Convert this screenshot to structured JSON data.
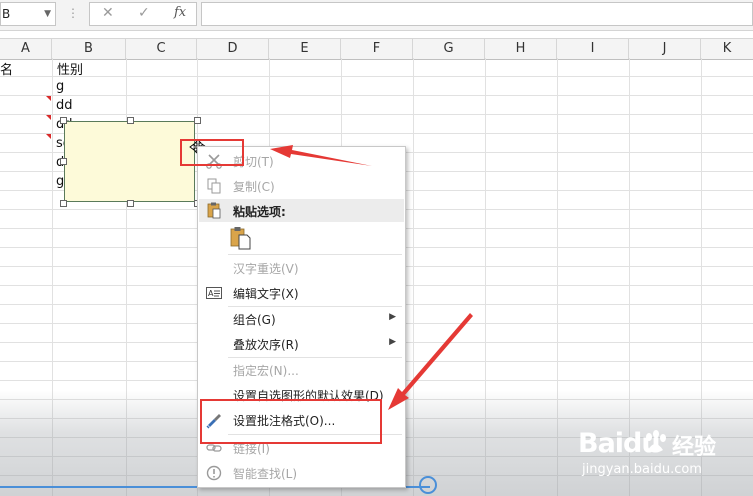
{
  "formula_bar": {
    "name_box": "B",
    "cancel_icon": "✕",
    "enter_icon": "✓",
    "fx_label": "fx"
  },
  "columns": [
    "A",
    "B",
    "C",
    "D",
    "E",
    "F",
    "G",
    "H",
    "I",
    "J",
    "K"
  ],
  "cells": {
    "a1": "名",
    "b1": "性别",
    "b2": "g",
    "b3": "dd",
    "b4": "dd",
    "b5": "sd",
    "b6": "d3",
    "b7": "g"
  },
  "context_menu": {
    "cut": "剪切(T)",
    "copy": "复制(C)",
    "paste_options": "粘贴选项:",
    "reselect_hanzi": "汉字重选(V)",
    "edit_text": "编辑文字(X)",
    "group": "组合(G)",
    "order": "叠放次序(R)",
    "assign_macro": "指定宏(N)...",
    "set_default_shape": "设置自选图形的默认效果(D)",
    "format_comment": "设置批注格式(O)...",
    "link": "链接(I)",
    "smart_lookup": "智能查找(L)"
  },
  "watermark": {
    "brand": "Baidu",
    "cn": "经验",
    "url": "jingyan.baidu.com"
  },
  "colors": {
    "annotation_red": "#e53935",
    "comment_fill": "#fdfad9",
    "accent_blue": "#4a8fd8"
  }
}
